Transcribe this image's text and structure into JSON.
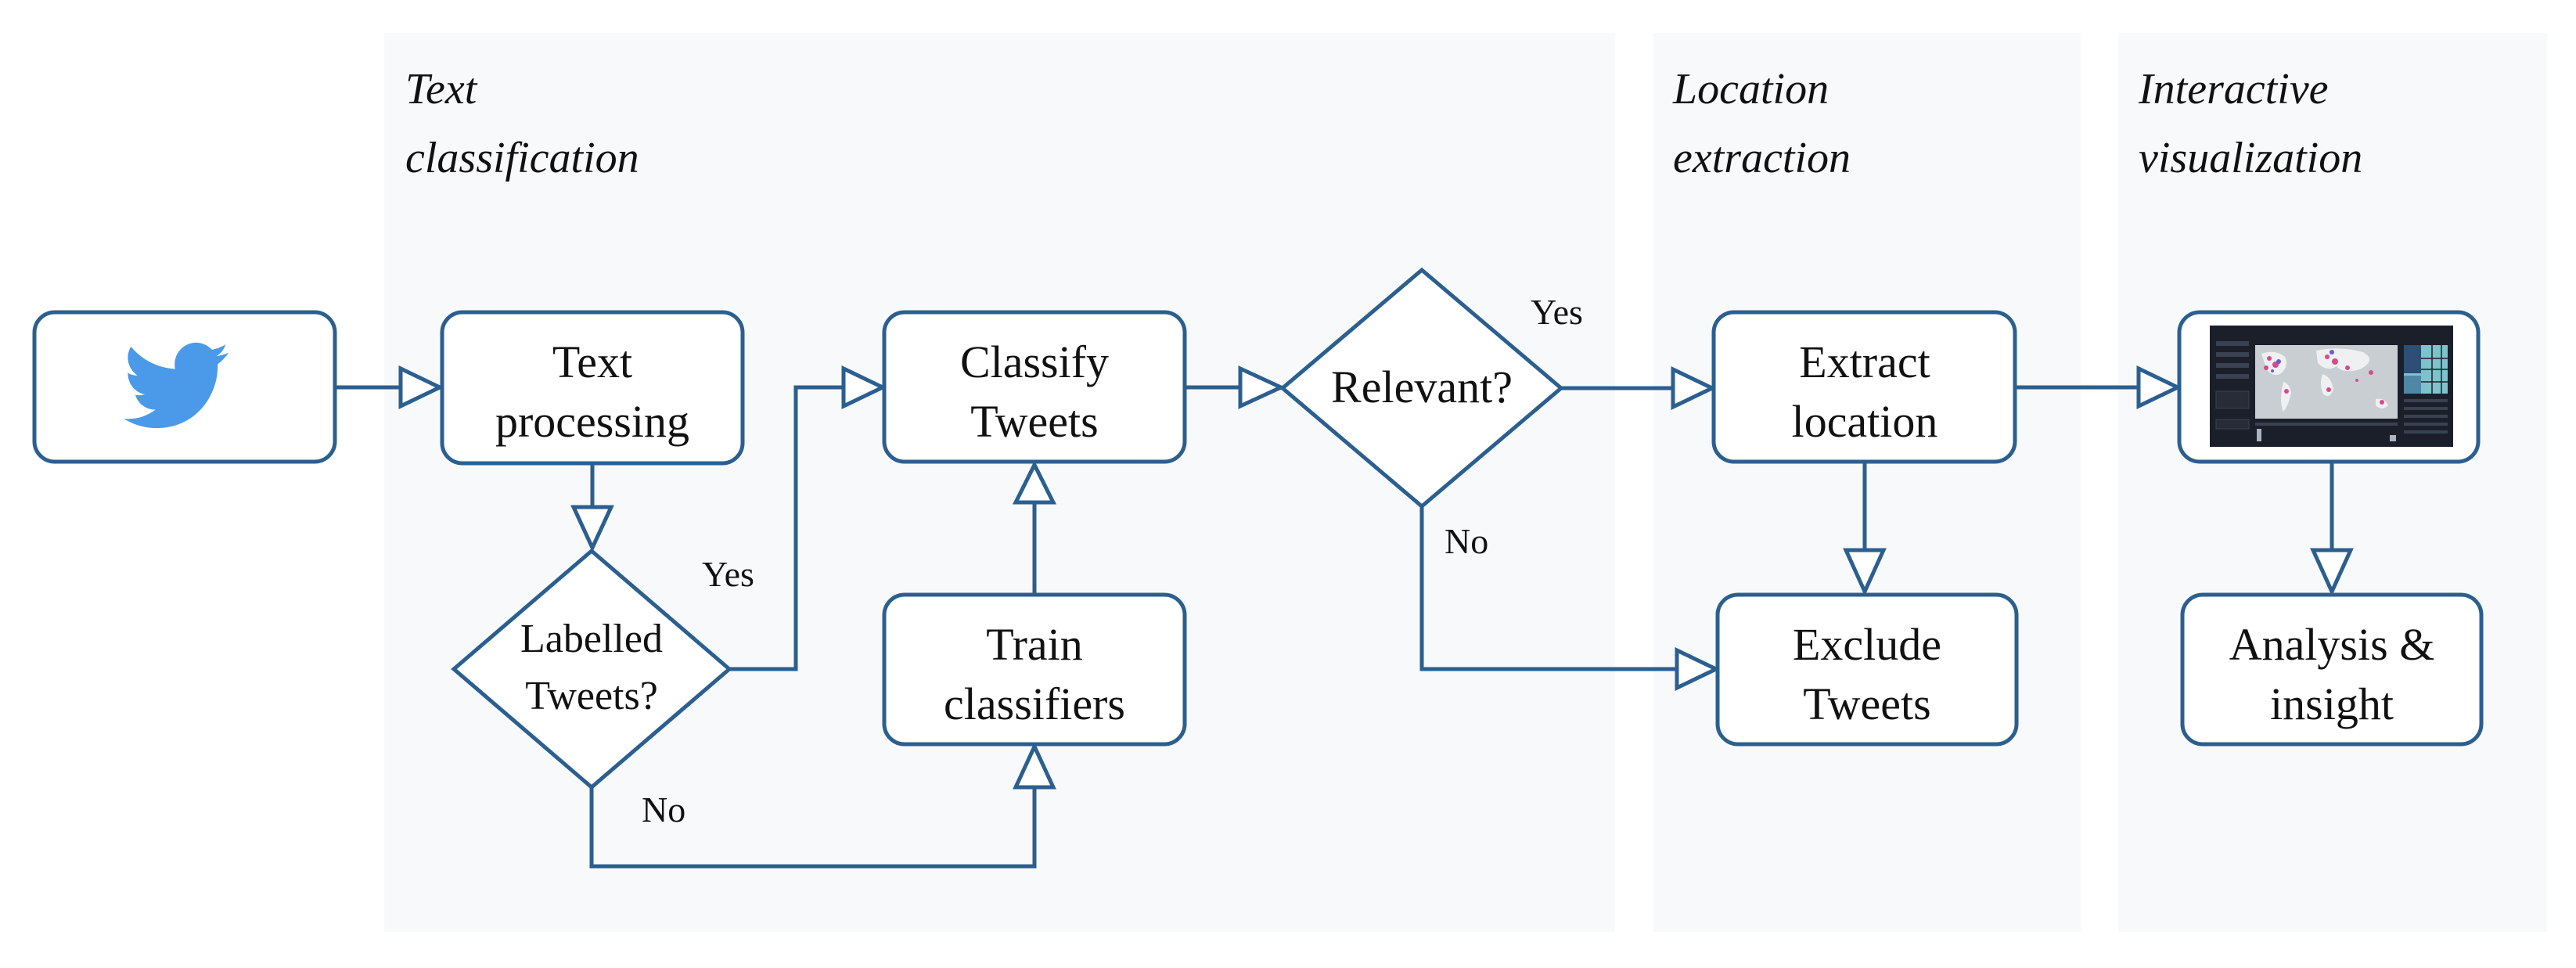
{
  "diagram": {
    "type": "flowchart",
    "colors": {
      "stroke": "#2b5f8f",
      "section_background": "#f8f9fa",
      "twitter_blue": "#4a9ae9"
    },
    "sections": [
      {
        "id": "text-classification",
        "title_lines": [
          "Text",
          "classification"
        ]
      },
      {
        "id": "location-extraction",
        "title_lines": [
          "Location",
          "extraction"
        ]
      },
      {
        "id": "interactive-visualization",
        "title_lines": [
          "Interactive",
          "visualization"
        ]
      }
    ],
    "nodes": {
      "twitter": {
        "kind": "icon",
        "icon": "twitter-bird-icon"
      },
      "text_processing": {
        "kind": "process",
        "lines": [
          "Text",
          "processing"
        ]
      },
      "labelled": {
        "kind": "decision",
        "lines": [
          "Labelled",
          "Tweets?"
        ]
      },
      "classify": {
        "kind": "process",
        "lines": [
          "Classify",
          "Tweets"
        ]
      },
      "train": {
        "kind": "process",
        "lines": [
          "Train",
          "classifiers"
        ]
      },
      "relevant": {
        "kind": "decision",
        "lines": [
          "Relevant?"
        ]
      },
      "extract": {
        "kind": "process",
        "lines": [
          "Extract",
          "location"
        ]
      },
      "exclude": {
        "kind": "process",
        "lines": [
          "Exclude",
          "Tweets"
        ]
      },
      "visualization": {
        "kind": "image",
        "icon": "dashboard-thumbnail-icon"
      },
      "analysis": {
        "kind": "process",
        "lines": [
          "Analysis &",
          "insight"
        ]
      }
    },
    "edges": [
      {
        "from": "twitter",
        "to": "text_processing",
        "label": ""
      },
      {
        "from": "text_processing",
        "to": "labelled",
        "label": ""
      },
      {
        "from": "labelled",
        "to": "classify",
        "label": "Yes"
      },
      {
        "from": "labelled",
        "to": "train",
        "label": "No"
      },
      {
        "from": "train",
        "to": "classify",
        "label": ""
      },
      {
        "from": "classify",
        "to": "relevant",
        "label": ""
      },
      {
        "from": "relevant",
        "to": "extract",
        "label": "Yes"
      },
      {
        "from": "relevant",
        "to": "exclude",
        "label": "No"
      },
      {
        "from": "extract",
        "to": "exclude",
        "label": ""
      },
      {
        "from": "extract",
        "to": "visualization",
        "label": ""
      },
      {
        "from": "visualization",
        "to": "analysis",
        "label": ""
      }
    ],
    "edge_labels": {
      "labelled_yes": "Yes",
      "labelled_no": "No",
      "relevant_yes": "Yes",
      "relevant_no": "No"
    }
  }
}
